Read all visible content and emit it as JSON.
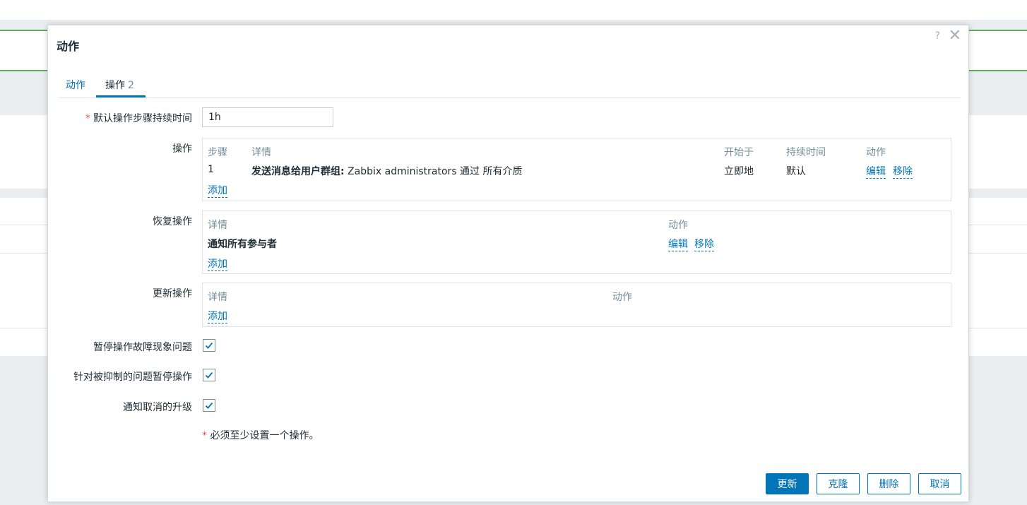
{
  "dialog": {
    "title": "动作",
    "help_icon": "?",
    "close_icon": "✕"
  },
  "tabs": [
    {
      "label": "动作",
      "count": ""
    },
    {
      "label": "操作",
      "count": "2"
    }
  ],
  "form": {
    "default_step_duration": {
      "label": "默认操作步骤持续时间",
      "required": "*",
      "value": "1h"
    },
    "operations": {
      "label": "操作",
      "headers": {
        "step": "步骤",
        "details": "详情",
        "start_in": "开始于",
        "duration": "持续时间",
        "action": "动作"
      },
      "rows": [
        {
          "step": "1",
          "details_bold": "发送消息给用户群组:",
          "details_text": " Zabbix administrators 通过 所有介质",
          "start_in": "立即地",
          "duration": "默认",
          "edit": "编辑",
          "remove": "移除"
        }
      ],
      "add": "添加"
    },
    "recovery_operations": {
      "label": "恢复操作",
      "headers": {
        "details": "详情",
        "action": "动作"
      },
      "rows": [
        {
          "details": "通知所有参与者",
          "edit": "编辑",
          "remove": "移除"
        }
      ],
      "add": "添加"
    },
    "update_operations": {
      "label": "更新操作",
      "headers": {
        "details": "详情",
        "action": "动作"
      },
      "add": "添加"
    },
    "checkboxes": [
      {
        "label": "暂停操作故障现象问题",
        "checked": true
      },
      {
        "label": "针对被抑制的问题暂停操作",
        "checked": true
      },
      {
        "label": "通知取消的升级",
        "checked": true
      }
    ],
    "required_note": {
      "star": "*",
      "text": " 必须至少设置一个操作。"
    }
  },
  "buttons": {
    "update": "更新",
    "clone": "克隆",
    "delete": "删除",
    "cancel": "取消"
  },
  "colors": {
    "accent": "#0275b8",
    "required": "#e45959",
    "header_text": "#768d99",
    "status_green": "#59b159"
  }
}
